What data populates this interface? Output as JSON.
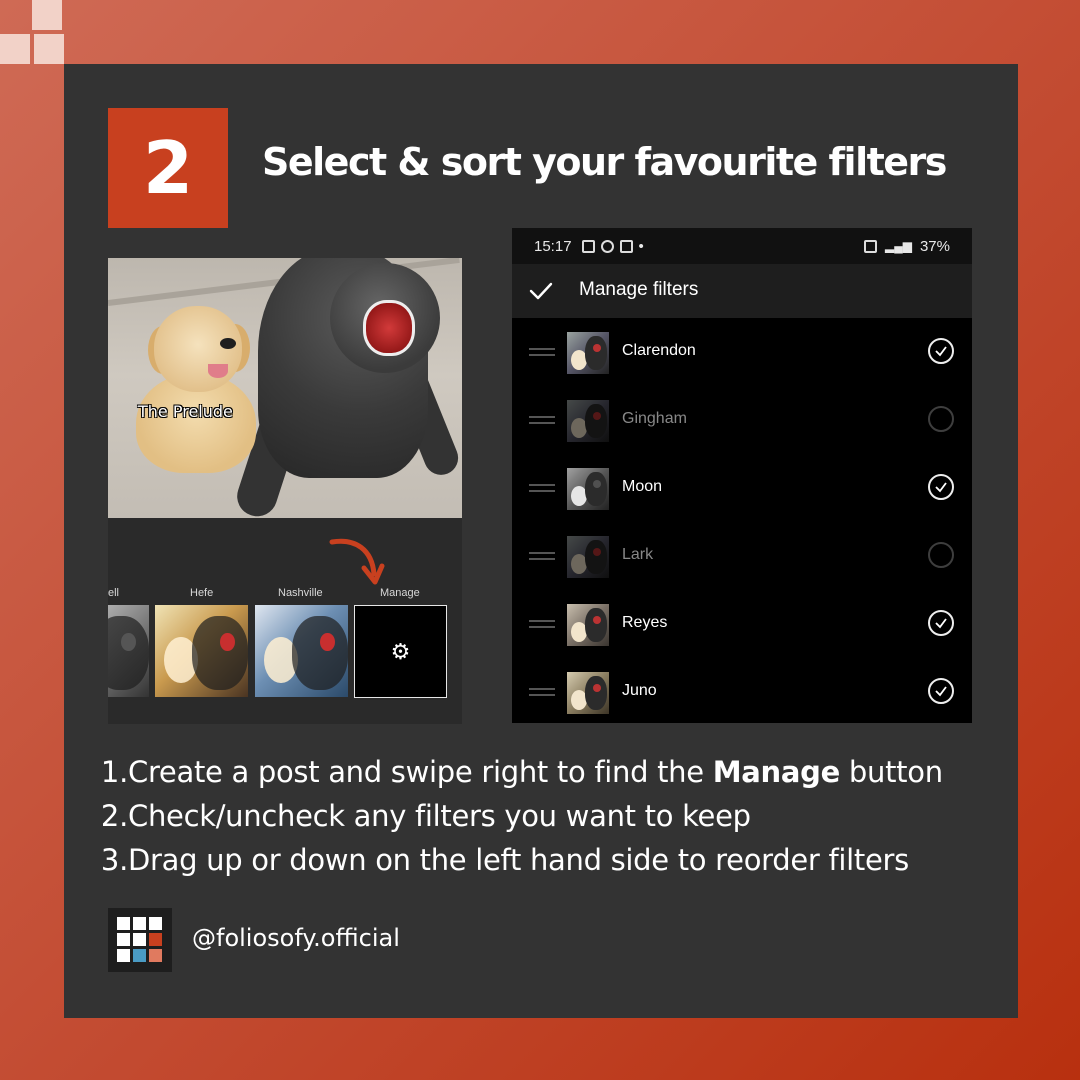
{
  "step": {
    "number": "2",
    "title": "Select & sort your favourite filters"
  },
  "left_screenshot": {
    "photo_caption": "The Prelude",
    "filters": [
      {
        "label": "ell",
        "style": "bw"
      },
      {
        "label": "Hefe",
        "style": "hefe"
      },
      {
        "label": "Nashville",
        "style": "nash"
      },
      {
        "label": "Manage",
        "style": "manage"
      }
    ],
    "manage_icon": "gear-icon"
  },
  "right_screenshot": {
    "status_bar": {
      "time": "15:17",
      "battery": "37%"
    },
    "title": "Manage filters",
    "filters": [
      {
        "name": "Clarendon",
        "checked": true
      },
      {
        "name": "Gingham",
        "checked": false
      },
      {
        "name": "Moon",
        "checked": true
      },
      {
        "name": "Lark",
        "checked": false
      },
      {
        "name": "Reyes",
        "checked": true
      },
      {
        "name": "Juno",
        "checked": true
      }
    ]
  },
  "instructions": [
    {
      "num": "1.",
      "before": "Create a post and swipe right to find the ",
      "bold": "Manage",
      "after": " button"
    },
    {
      "num": "2.",
      "before": "Check/uncheck any filters you want to keep",
      "bold": "",
      "after": ""
    },
    {
      "num": "3.",
      "before": "Drag up or down on the left hand side to reorder filters",
      "bold": "",
      "after": ""
    }
  ],
  "footer": {
    "handle": "@foliosofy.official"
  },
  "colors": {
    "accent": "#c8401f",
    "card": "#333333",
    "logo_red": "#c8401f",
    "logo_blue": "#4a9bc4",
    "logo_salmon": "#e07a5f"
  }
}
